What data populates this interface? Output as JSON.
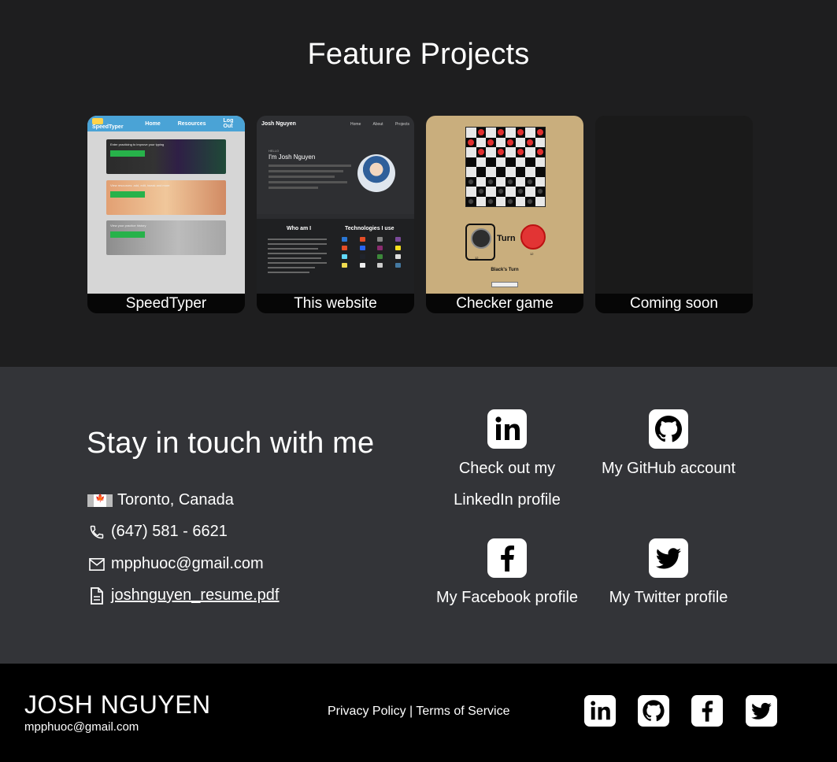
{
  "projects": {
    "title": "Feature Projects",
    "items": [
      {
        "caption": "SpeedTyper",
        "thumb": {
          "nav": [
            "SpeedTyper",
            "Home",
            "Resources",
            "Log Out"
          ],
          "panels": [
            {
              "text": "Enter practicing to improve your typing",
              "button": "Practice yourself"
            },
            {
              "text": "View resources: add, edit, tweak and more",
              "button": "View Collection"
            },
            {
              "text": "View your practice history",
              "button": "View History"
            }
          ]
        }
      },
      {
        "caption": "This website",
        "thumb": {
          "brand": "Josh Nguyen",
          "links": "Home About Projects",
          "hello": "HELLO",
          "name": "I'm Josh Nguyen",
          "who": "Who am I",
          "tech": "Technologies I use"
        }
      },
      {
        "caption": "Checker game",
        "thumb": {
          "turn": "Turn",
          "status": "Black's Turn",
          "reset": "Reset",
          "remaining_black": "12",
          "remaining_red": "12"
        }
      },
      {
        "caption": "Coming soon"
      }
    ]
  },
  "contact": {
    "title": "Stay in touch with me",
    "location": "Toronto, Canada",
    "phone": "(647) 581 - 6621",
    "email": "mpphuoc@gmail.com",
    "resume": "joshnguyen_resume.pdf",
    "social": {
      "linkedin_line1": "Check out my",
      "linkedin_line2": "LinkedIn profile",
      "github": "My GitHub account",
      "facebook": "My Facebook profile",
      "twitter": "My Twitter profile"
    }
  },
  "footer": {
    "name": "JOSH NGUYEN",
    "email": "mpphuoc@gmail.com",
    "privacy": "Privacy Policy",
    "separator": "|",
    "terms": "Terms of Service"
  },
  "colors": {
    "projects_bg": "#1e1e1f",
    "contact_bg": "#333438",
    "footer_bg": "#000000",
    "text": "#ffffff"
  },
  "icons": [
    "maple-leaf-flag",
    "phone-icon",
    "mail-icon",
    "document-icon",
    "linkedin-icon",
    "github-icon",
    "facebook-icon",
    "twitter-icon"
  ]
}
